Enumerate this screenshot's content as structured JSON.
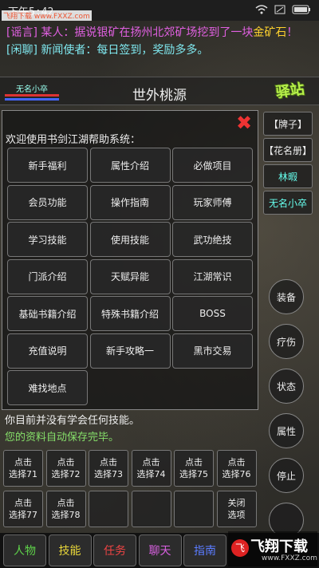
{
  "status": {
    "time": "下午5:42",
    "right_icons": [
      "wifi-icon",
      "sim-icon",
      "battery-icon"
    ]
  },
  "watermark_top": "飞翔下载 www.FXXZ.com",
  "chat": [
    {
      "tag": "[谣言]",
      "speaker": "某人：",
      "text": "据说银矿在扬州北郊矿场挖到了一块",
      "highlight": "金矿石",
      "end": "！"
    },
    {
      "tag": "[闲聊]",
      "speaker": "新闻使者：",
      "text": "每日签到，奖励多多。"
    }
  ],
  "header": {
    "player": "无名小卒",
    "location": "世外桃源",
    "station_label": "驿站"
  },
  "dialog": {
    "welcome": "欢迎使用书剑江湖帮助系统：",
    "close_glyph": "✖",
    "buttons": [
      "新手福利",
      "属性介绍",
      "必做项目",
      "会员功能",
      "操作指南",
      "玩家师傅",
      "学习技能",
      "使用技能",
      "武功绝技",
      "门派介绍",
      "天赋异能",
      "江湖常识",
      "基础书籍介绍",
      "特殊书籍介绍",
      "BOSS",
      "充值说明",
      "新手攻略一",
      "黑市交易",
      "难找地点"
    ]
  },
  "side": {
    "top": [
      "【牌子】",
      "【花名册】",
      "林暇",
      "无名小卒"
    ],
    "round": [
      "装备",
      "疗伤",
      "状态",
      "属性",
      "停止",
      ""
    ]
  },
  "messages": [
    "你目前并没有学会任何技能。",
    "您的资料自动保存完毕。"
  ],
  "slots": [
    "点击\n选择71",
    "点击\n选择72",
    "点击\n选择73",
    "点击\n选择74",
    "点击\n选择75",
    "点击\n选择76",
    "点击\n选择77",
    "点击\n选择78",
    "",
    "",
    "",
    "关闭\n选项"
  ],
  "tabs": [
    {
      "label": "人物",
      "color": "#5fd34a"
    },
    {
      "label": "技能",
      "color": "#e8d63a"
    },
    {
      "label": "任务",
      "color": "#ee4444"
    },
    {
      "label": "聊天",
      "color": "#d860e0"
    },
    {
      "label": "指南",
      "color": "#5b7cff"
    }
  ],
  "watermark_br": {
    "big": "飞翔下载",
    "small": "www.FXXZ.com",
    "logo": "飞"
  }
}
